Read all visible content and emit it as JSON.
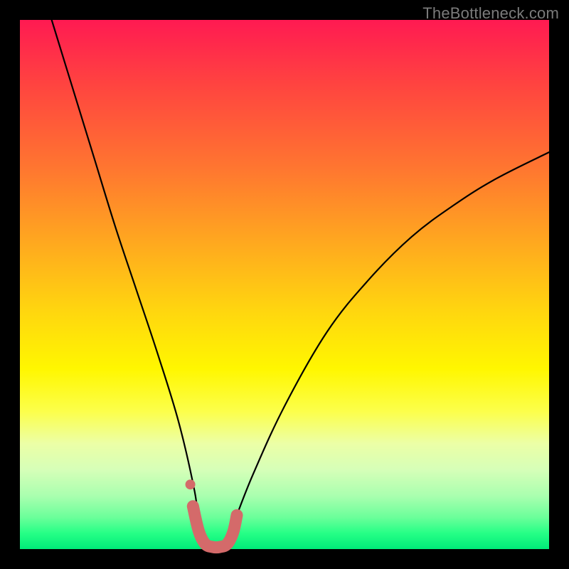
{
  "watermark": "TheBottleneck.com",
  "chart_data": {
    "type": "line",
    "title": "",
    "xlabel": "",
    "ylabel": "",
    "xlim": [
      0,
      100
    ],
    "ylim": [
      0,
      100
    ],
    "grid": false,
    "series": [
      {
        "name": "bottleneck-curve",
        "color": "#000000",
        "x": [
          6,
          10,
          14,
          18,
          22,
          26,
          30,
          33,
          34,
          36,
          38,
          40,
          44,
          50,
          58,
          66,
          74,
          82,
          90,
          100
        ],
        "values": [
          100,
          87,
          74,
          61,
          49,
          37,
          24,
          11,
          4,
          0.5,
          0.5,
          4,
          14,
          27,
          41,
          51,
          59,
          65,
          70,
          75
        ]
      },
      {
        "name": "optimal-marker",
        "color": "#d46a6a",
        "x": [
          32.7,
          33.8,
          35.0,
          36.4,
          37.8,
          39.2,
          40.3,
          41.0
        ],
        "values": [
          8.1,
          3.4,
          1.0,
          0.4,
          0.4,
          1.0,
          3.2,
          6.4
        ]
      },
      {
        "name": "optimal-marker-dot",
        "color": "#d46a6a",
        "x": [
          32.2
        ],
        "values": [
          12.2
        ]
      }
    ]
  }
}
